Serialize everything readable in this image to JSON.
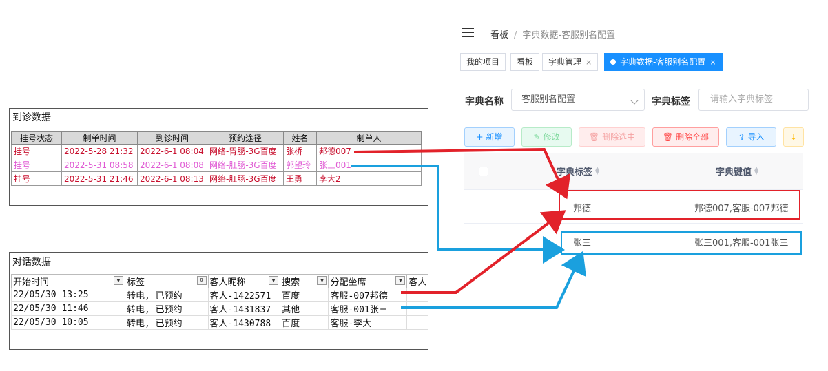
{
  "visit": {
    "title": "到诊数据",
    "headers": [
      "挂号状态",
      "制单时间",
      "到诊时间",
      "预约途径",
      "姓名",
      "制单人"
    ],
    "rows": [
      [
        "挂号",
        "2022-5-28 21:32",
        "2022-6-1 08:04",
        "网络-胃肠-3G百度",
        "张桥",
        "邦德007"
      ],
      [
        "挂号",
        "2022-5-31 08:58",
        "2022-6-1 08:08",
        "网络-肛肠-3G百度",
        "郭望玲",
        "张三001"
      ],
      [
        "挂号",
        "2022-5-31 21:46",
        "2022-6-1 08:13",
        "网络-肛肠-3G百度",
        "王勇",
        "李大2"
      ]
    ]
  },
  "chat": {
    "title": "对话数据",
    "headers": [
      "开始时间",
      "标签",
      "客人昵称",
      "搜索",
      "分配坐席",
      "客人"
    ],
    "rows": [
      [
        "22/05/30 13:25",
        "转电, 已预约",
        "客人-1422571",
        "百度",
        "客服-007邦德"
      ],
      [
        "22/05/30 11:46",
        "转电, 已预约",
        "客人-1431837",
        "其他",
        "客服-001张三"
      ],
      [
        "22/05/30 10:05",
        "转电, 已预约",
        "客人-1430788",
        "百度",
        "客服-李大"
      ]
    ]
  },
  "breadcrumb": {
    "root": "看板",
    "sep": "/",
    "current": "字典数据-客服别名配置"
  },
  "tags": [
    {
      "label": "我的项目",
      "closable": false,
      "active": false
    },
    {
      "label": "看板",
      "closable": false,
      "active": false
    },
    {
      "label": "字典管理",
      "closable": true,
      "active": false
    },
    {
      "label": "字典数据-客服别名配置",
      "closable": true,
      "active": true
    }
  ],
  "tag_close": "×",
  "form": {
    "dict_name_label": "字典名称",
    "dict_name_value": "客服别名配置",
    "dict_label_label": "字典标签",
    "dict_label_placeholder": "请输入字典标签"
  },
  "buttons": {
    "add": {
      "icon": "+",
      "label": "新增"
    },
    "edit": {
      "icon": "✎",
      "label": "修改"
    },
    "delete_selected": {
      "icon": "🗑",
      "label": "删除选中"
    },
    "delete_all": {
      "icon": "🗑",
      "label": "删除全部"
    },
    "import": {
      "icon": "⇪",
      "label": "导入"
    },
    "export": {
      "icon": "↓",
      "label": ""
    }
  },
  "dict_table": {
    "headers": {
      "label": "字典标签",
      "value": "字典键值"
    },
    "rows": [
      {
        "label": "邦德",
        "value": "邦德007,客服-007邦德"
      },
      {
        "label": "张三",
        "value": "张三001,客服-001张三"
      }
    ]
  },
  "colors": {
    "primary": "#1890ff",
    "arrow_red": "#e2222a",
    "arrow_blue": "#1aa0de",
    "text_red": "#c8102e",
    "text_pink": "#e05bd4"
  },
  "icons": [
    "menu-fold-icon",
    "filter-icon",
    "chevron-down-icon",
    "sort-icon",
    "close-icon"
  ]
}
